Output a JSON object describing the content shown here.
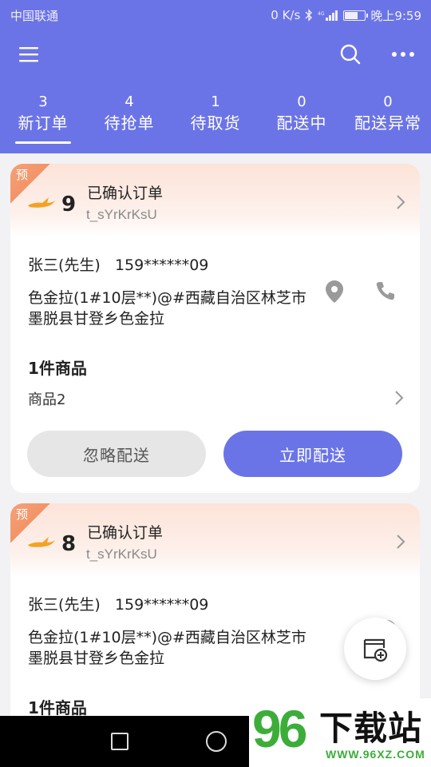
{
  "status_bar": {
    "carrier": "中国联通",
    "speed": "0 K/s",
    "time": "晚上9:59"
  },
  "tabs": [
    {
      "count": "3",
      "label": "新订单",
      "active": true
    },
    {
      "count": "4",
      "label": "待抢单"
    },
    {
      "count": "1",
      "label": "待取货"
    },
    {
      "count": "0",
      "label": "配送中"
    },
    {
      "count": "0",
      "label": "配送异常"
    }
  ],
  "orders": [
    {
      "badge": "预",
      "number": "9",
      "status": "已确认订单",
      "code": "t_sYrKrKsU",
      "customer": "张三(先生)",
      "phone": "159******09",
      "address": "色金拉(1#10层**)@#西藏自治区林芝市墨脱县甘登乡色金拉",
      "goods_count": "1件商品",
      "goods_name": "商品2",
      "ignore_label": "忽略配送",
      "deliver_label": "立即配送"
    },
    {
      "badge": "预",
      "number": "8",
      "status": "已确认订单",
      "code": "t_sYrKrKsU",
      "customer": "张三(先生)",
      "phone": "159******09",
      "address": "色金拉(1#10层**)@#西藏自治区林芝市墨脱县甘登乡色金拉",
      "goods_count": "1件商品"
    }
  ],
  "watermark": {
    "logo_number": "96",
    "title": "下载站",
    "url": "WWW.96XZ.COM"
  },
  "colors": {
    "primary": "#6b74e6",
    "badge": "#f39367",
    "watermark_green": "#3dad3a"
  },
  "icons": [
    "menu-icon",
    "search-icon",
    "more-icon",
    "bird-icon",
    "chevron-right-icon",
    "location-icon",
    "phone-icon",
    "add-order-icon"
  ]
}
